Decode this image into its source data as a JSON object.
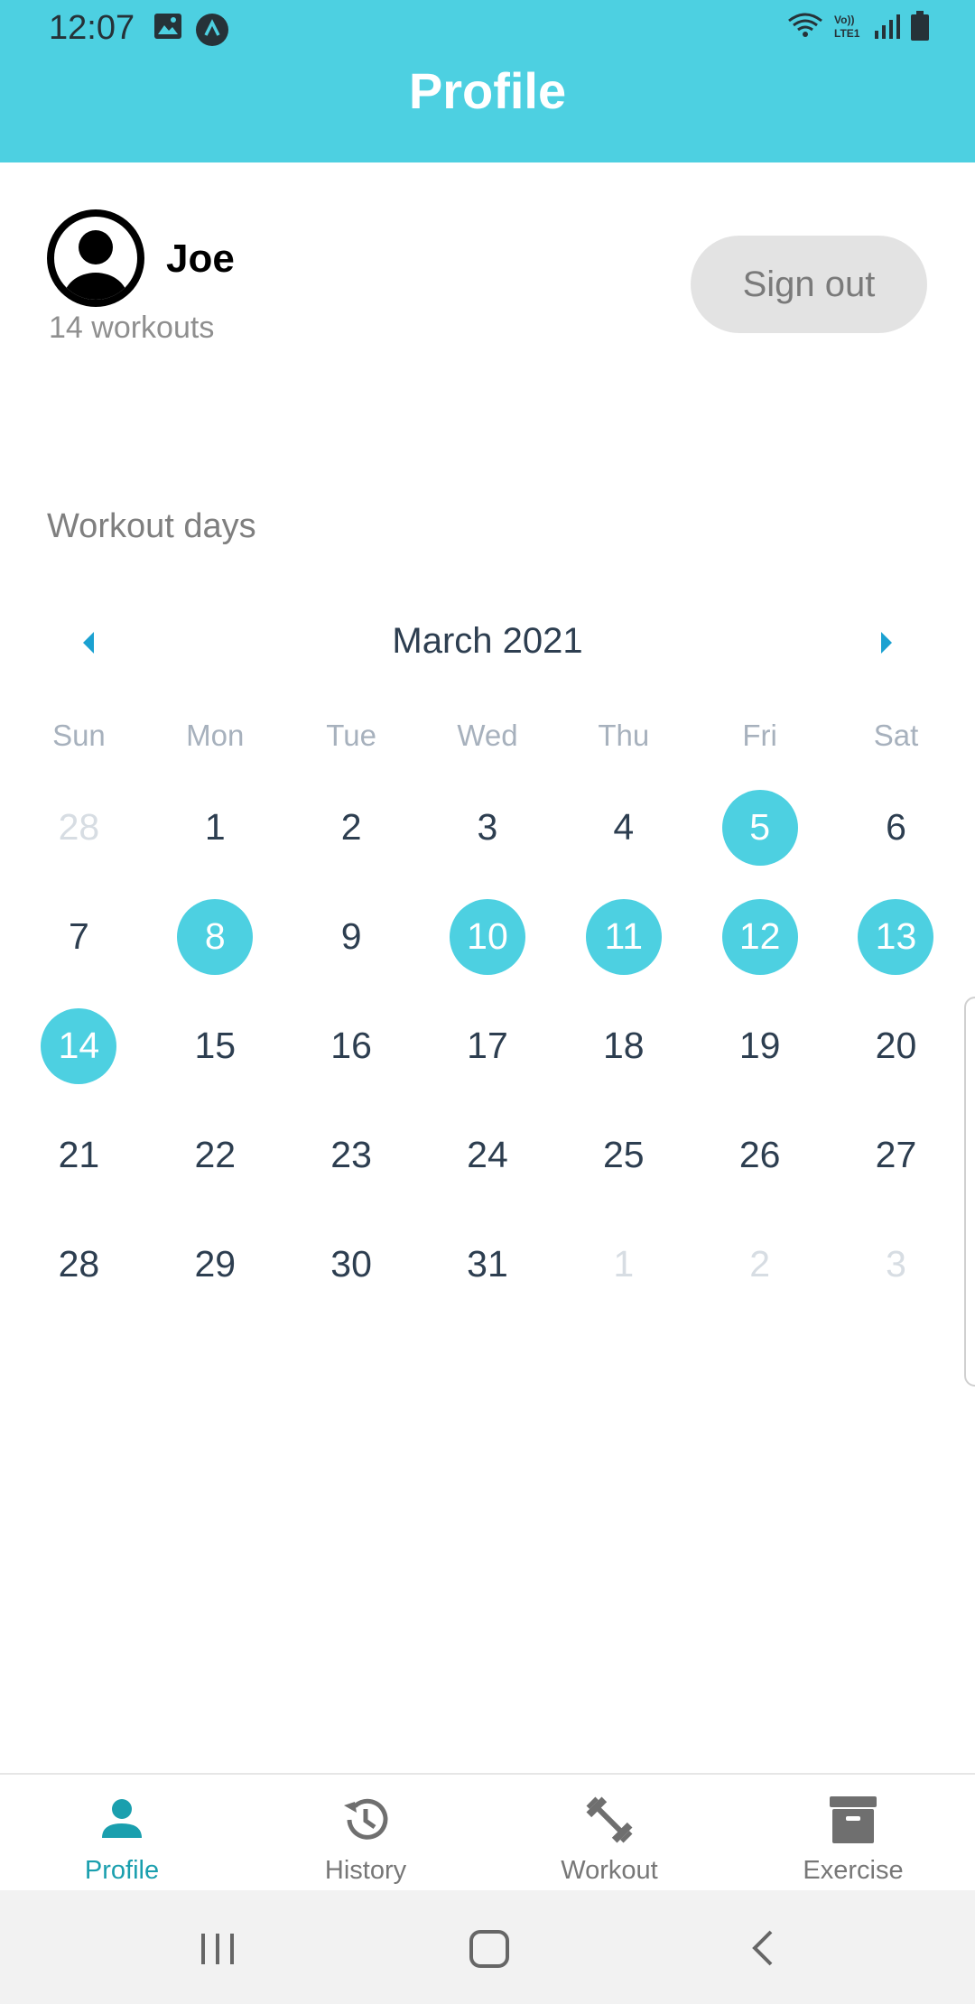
{
  "status_bar": {
    "time": "12:07",
    "left_icons": [
      "image-icon",
      "navigation-app-icon"
    ],
    "right_icons": [
      "wifi-icon",
      "volte-icon",
      "signal-icon",
      "battery-icon"
    ],
    "volte_label": "Vo))\nLTE1"
  },
  "header": {
    "title": "Profile",
    "background": "#4dd0e1"
  },
  "profile": {
    "name": "Joe",
    "workout_count": "14 workouts",
    "avatar_icon": "user-avatar-icon",
    "sign_out_label": "Sign out"
  },
  "workout_days": {
    "label": "Workout days"
  },
  "calendar": {
    "month_label": "March 2021",
    "prev_icon": "chevron-left-icon",
    "next_icon": "chevron-right-icon",
    "accent": "#4dd0e1",
    "weekdays": [
      "Sun",
      "Mon",
      "Tue",
      "Wed",
      "Thu",
      "Fri",
      "Sat"
    ],
    "days": [
      {
        "label": "28",
        "other_month": true,
        "marked": false
      },
      {
        "label": "1",
        "other_month": false,
        "marked": false
      },
      {
        "label": "2",
        "other_month": false,
        "marked": false
      },
      {
        "label": "3",
        "other_month": false,
        "marked": false
      },
      {
        "label": "4",
        "other_month": false,
        "marked": false
      },
      {
        "label": "5",
        "other_month": false,
        "marked": true
      },
      {
        "label": "6",
        "other_month": false,
        "marked": false
      },
      {
        "label": "7",
        "other_month": false,
        "marked": false
      },
      {
        "label": "8",
        "other_month": false,
        "marked": true
      },
      {
        "label": "9",
        "other_month": false,
        "marked": false
      },
      {
        "label": "10",
        "other_month": false,
        "marked": true
      },
      {
        "label": "11",
        "other_month": false,
        "marked": true
      },
      {
        "label": "12",
        "other_month": false,
        "marked": true
      },
      {
        "label": "13",
        "other_month": false,
        "marked": true
      },
      {
        "label": "14",
        "other_month": false,
        "marked": true
      },
      {
        "label": "15",
        "other_month": false,
        "marked": false
      },
      {
        "label": "16",
        "other_month": false,
        "marked": false
      },
      {
        "label": "17",
        "other_month": false,
        "marked": false
      },
      {
        "label": "18",
        "other_month": false,
        "marked": false
      },
      {
        "label": "19",
        "other_month": false,
        "marked": false
      },
      {
        "label": "20",
        "other_month": false,
        "marked": false
      },
      {
        "label": "21",
        "other_month": false,
        "marked": false
      },
      {
        "label": "22",
        "other_month": false,
        "marked": false
      },
      {
        "label": "23",
        "other_month": false,
        "marked": false
      },
      {
        "label": "24",
        "other_month": false,
        "marked": false
      },
      {
        "label": "25",
        "other_month": false,
        "marked": false
      },
      {
        "label": "26",
        "other_month": false,
        "marked": false
      },
      {
        "label": "27",
        "other_month": false,
        "marked": false
      },
      {
        "label": "28",
        "other_month": false,
        "marked": false
      },
      {
        "label": "29",
        "other_month": false,
        "marked": false
      },
      {
        "label": "30",
        "other_month": false,
        "marked": false
      },
      {
        "label": "31",
        "other_month": false,
        "marked": false
      },
      {
        "label": "1",
        "other_month": true,
        "marked": false
      },
      {
        "label": "2",
        "other_month": true,
        "marked": false
      },
      {
        "label": "3",
        "other_month": true,
        "marked": false
      }
    ]
  },
  "bottom_nav": {
    "active_color": "#1a9fae",
    "items": [
      {
        "label": "Profile",
        "icon": "person-icon",
        "active": true
      },
      {
        "label": "History",
        "icon": "history-icon",
        "active": false
      },
      {
        "label": "Workout",
        "icon": "dumbbell-icon",
        "active": false
      },
      {
        "label": "Exercise",
        "icon": "archive-icon",
        "active": false
      }
    ]
  },
  "system_nav": {
    "buttons": [
      "recent-apps-icon",
      "home-icon",
      "back-icon"
    ]
  }
}
